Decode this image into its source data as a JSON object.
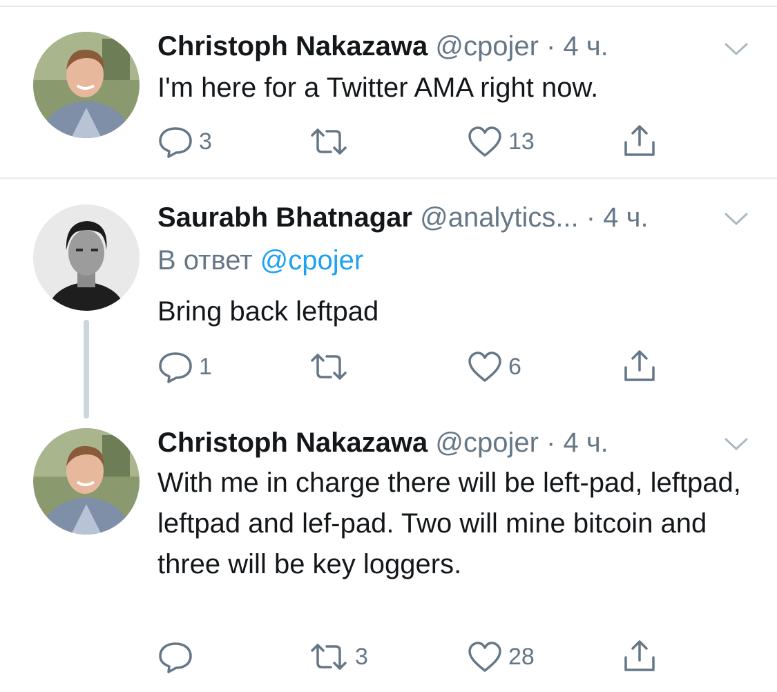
{
  "tweets": [
    {
      "name": "Christoph Nakazawa",
      "handle": "@cpojer",
      "dot": "·",
      "time": "4 ч.",
      "text": "I'm here for a Twitter AMA right now.",
      "reply_count": "3",
      "retweet_count": "",
      "like_count": "13"
    },
    {
      "name": "Saurabh Bhatnagar",
      "handle": "@analytics...",
      "dot": "·",
      "time": "4 ч.",
      "reply_prefix": "В ответ",
      "reply_handle": "@cpojer",
      "text": "Bring back leftpad",
      "reply_count": "1",
      "retweet_count": "",
      "like_count": "6"
    },
    {
      "name": "Christoph Nakazawa",
      "handle": "@cpojer",
      "dot": "·",
      "time": "4 ч.",
      "text": "With me in charge there will be left-pad, leftpad, leftpad and lef-pad. Two will mine bitcoin and three will be key loggers.",
      "reply_count": "",
      "retweet_count": "3",
      "like_count": "28"
    }
  ],
  "icons": {
    "reply": "reply-icon",
    "retweet": "retweet-icon",
    "like": "heart-icon",
    "share": "share-icon",
    "caret": "chevron-down-icon"
  },
  "colors": {
    "text": "#14171a",
    "secondary": "#657786",
    "link": "#1da1f2",
    "divider": "#e6ecf0",
    "thread_line": "#ccd6dd"
  }
}
